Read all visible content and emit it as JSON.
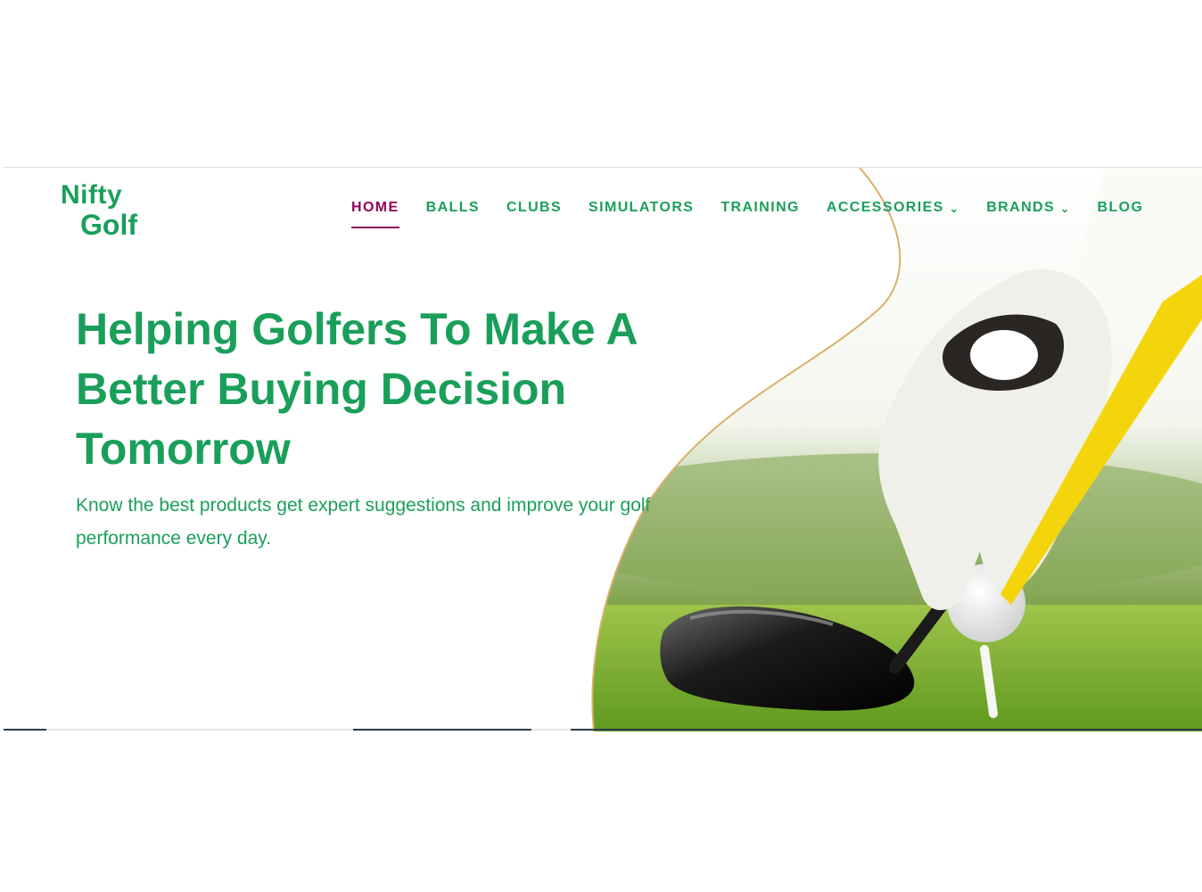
{
  "brand": {
    "logo_line1": "Nifty",
    "logo_line2": "Golf"
  },
  "nav": {
    "items": [
      {
        "label": "HOME",
        "active": true,
        "has_dropdown": false
      },
      {
        "label": "BALLS",
        "active": false,
        "has_dropdown": false
      },
      {
        "label": "CLUBS",
        "active": false,
        "has_dropdown": false
      },
      {
        "label": "SIMULATORS",
        "active": false,
        "has_dropdown": false
      },
      {
        "label": "TRAINING",
        "active": false,
        "has_dropdown": false
      },
      {
        "label": "ACCESSORIES",
        "active": false,
        "has_dropdown": true
      },
      {
        "label": "BRANDS",
        "active": false,
        "has_dropdown": true
      },
      {
        "label": "BLOG",
        "active": false,
        "has_dropdown": false
      }
    ]
  },
  "hero": {
    "headline": "Helping Golfers To Make A Better Buying Decision Tomorrow",
    "subtext": "Know the best products get expert suggestions and improve your golf performance every day.",
    "image_icon": "golf-glove-tee-image"
  },
  "colors": {
    "brand_green": "#1a9f5a",
    "active_magenta": "#93005a",
    "gold_border": "#d8b06a"
  }
}
